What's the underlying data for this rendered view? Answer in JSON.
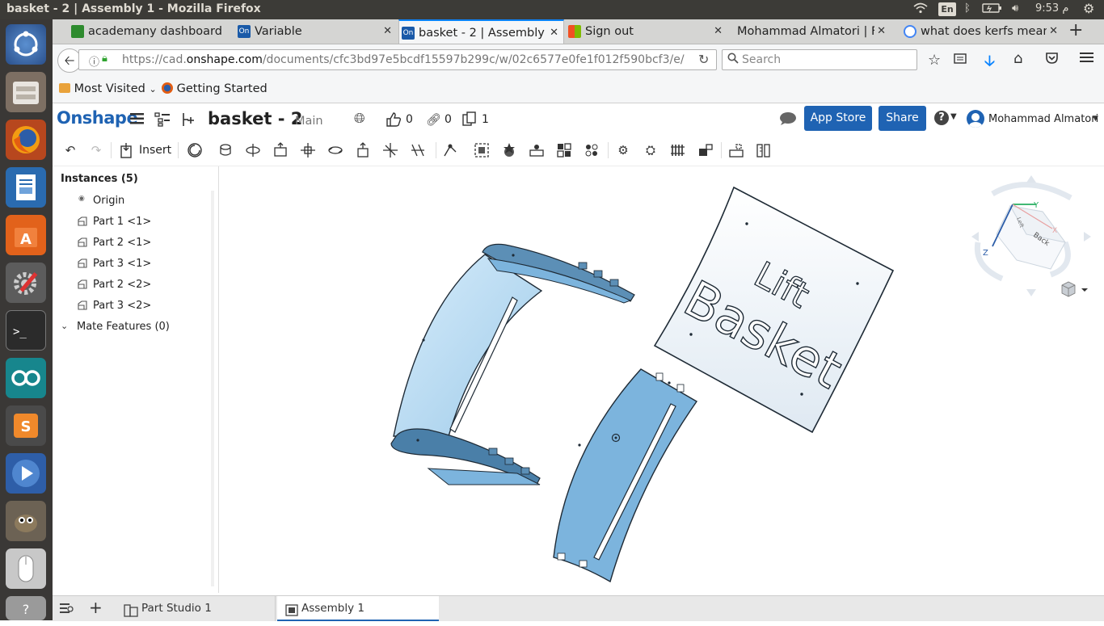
{
  "window": {
    "title": "basket - 2 | Assembly 1 - Mozilla Firefox",
    "keyboard_layout": "En",
    "clock": "9:53 م"
  },
  "launcher": {
    "items": [
      "ubuntu-dash-icon",
      "files-icon",
      "firefox-icon",
      "writer-icon",
      "software-center-icon",
      "settings-icon",
      "terminal-icon",
      "arduino-icon",
      "sublime-icon",
      "video-player-icon",
      "gimp-icon",
      "mouse-icon",
      "help-icon"
    ]
  },
  "tabs": [
    {
      "label": "academany dashboard",
      "favicon_color": "#2e8b2e"
    },
    {
      "label": "Variable",
      "favicon_color": "#1a5aa8"
    },
    {
      "label": "basket - 2 | Assembly 1",
      "favicon_color": "#1a5aa8"
    },
    {
      "label": "Sign out",
      "favicon_color": "#f25022"
    },
    {
      "label": "Mohammad Almatori | Fa",
      "favicon_color": ""
    },
    {
      "label": "what does kerfs mean",
      "favicon_color": "#4285f4"
    }
  ],
  "url": {
    "prefix": "https://cad.",
    "domain": "onshape.com",
    "path": "/documents/cfc3bd97e5bcdf15597b299c/w/02c6577e0fe1f012f590bcf3/e/"
  },
  "search": {
    "placeholder": "Search"
  },
  "bookmarks": {
    "most_visited": "Most Visited",
    "getting_started": "Getting Started"
  },
  "onshape": {
    "logo": "Onshape",
    "doc_title": "basket - 2",
    "branch": "Main",
    "likes": "0",
    "links": "0",
    "copies": "1",
    "app_store": "App Store",
    "share": "Share",
    "user": "Mohammad Almatori",
    "insert": "Insert"
  },
  "tree": {
    "header": "Instances (5)",
    "origin": "Origin",
    "instances": [
      "Part 1 <1>",
      "Part 2 <1>",
      "Part 3 <1>",
      "Part 2 <2>",
      "Part 3 <2>"
    ],
    "mate_features": "Mate Features (0)"
  },
  "viewcube": {
    "y": "Y",
    "x": "X",
    "z": "Z",
    "face_front": "Back",
    "face_side": "Left"
  },
  "model_text": {
    "line1": "Lift",
    "line2": "Basket"
  },
  "bottom_tabs": [
    "Part Studio 1",
    "Assembly 1"
  ],
  "colors": {
    "accent": "#1f63b3",
    "part_blue": "#7cb4dd",
    "part_dark": "#4a7fa8"
  }
}
